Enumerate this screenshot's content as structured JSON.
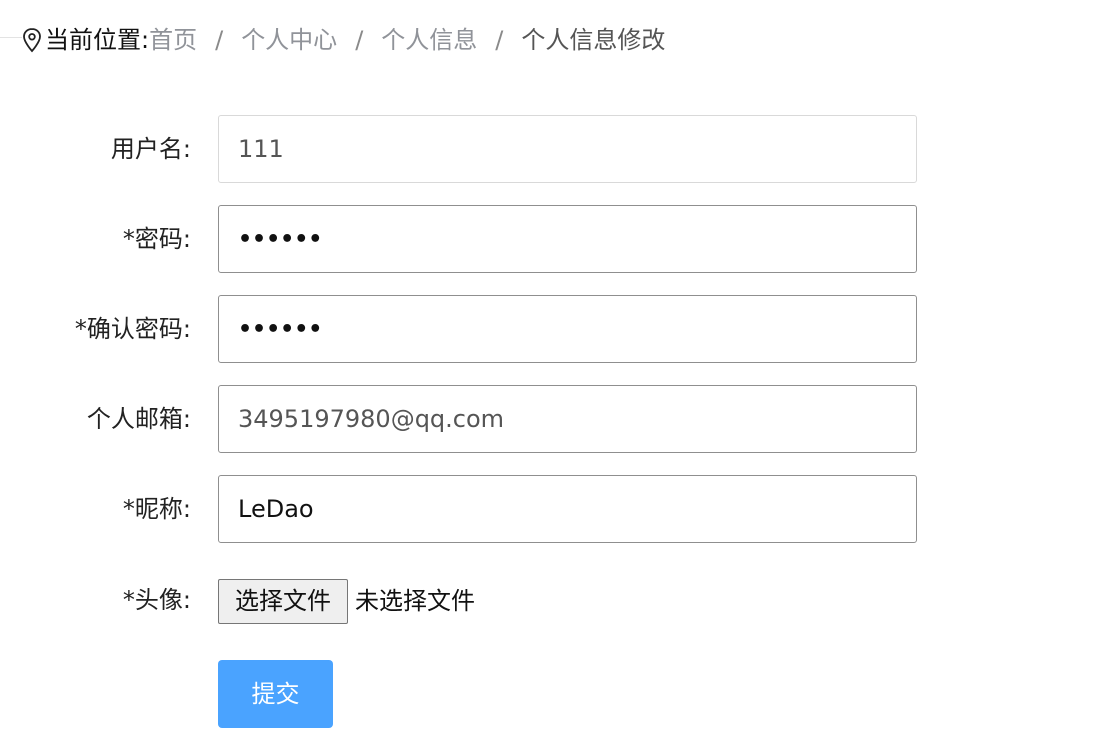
{
  "breadcrumb": {
    "icon": "location-pin-icon",
    "prefix": "当前位置:",
    "items": [
      "首页",
      "个人中心",
      "个人信息"
    ],
    "current": "个人信息修改",
    "separator": "/"
  },
  "form": {
    "username": {
      "label": "用户名:",
      "value": "111"
    },
    "password": {
      "label": "*密码:",
      "value": "••••••"
    },
    "confirm_password": {
      "label": "*确认密码:",
      "value": "••••••"
    },
    "email": {
      "label": "个人邮箱:",
      "value": "3495197980@qq.com"
    },
    "nickname": {
      "label": "*昵称:",
      "value": "LeDao"
    },
    "avatar": {
      "label": "*头像:",
      "button_label": "选择文件",
      "status": "未选择文件"
    },
    "submit_label": "提交"
  },
  "colors": {
    "submit_button": "#4aa3ff",
    "breadcrumb_link": "#909399"
  }
}
